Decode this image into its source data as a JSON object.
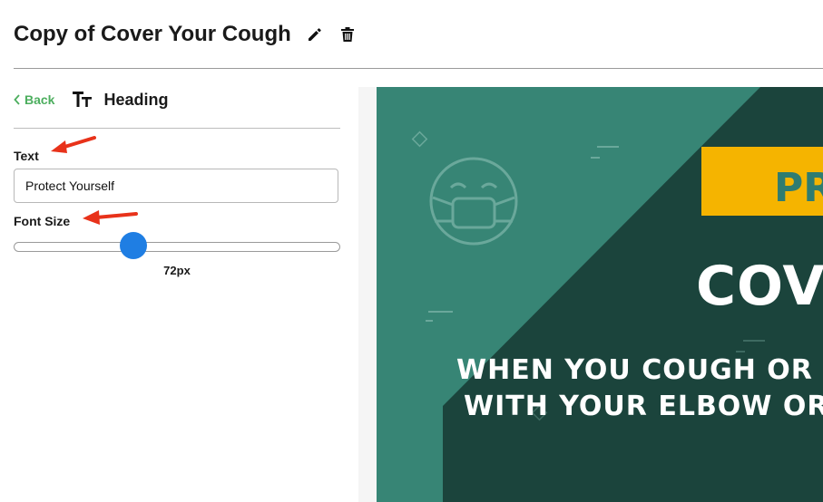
{
  "page": {
    "title": "Copy of Cover Your Cough"
  },
  "toolbar": {
    "edit_icon": "pencil-icon",
    "delete_icon": "trash-icon"
  },
  "panel": {
    "back_label": "Back",
    "section_icon": "text-type-icon",
    "section_title": "Heading",
    "text_label": "Text",
    "text_value": "Protect Yourself",
    "font_size_label": "Font Size",
    "font_size_value": "72px",
    "font_size_fraction": 0.37
  },
  "preview": {
    "badge_text": "PR",
    "headline": "COVE",
    "subline_1": "WHEN YOU COUGH OR SNE",
    "subline_2": "WITH YOUR ELBOW OR A T",
    "colors": {
      "teal": "#378575",
      "dark_green": "#1b443c",
      "badge": "#f5b400",
      "badge_text": "#2f7c70"
    }
  },
  "colors": {
    "accent_green": "#4cae5e",
    "slider_blue": "#1f7ee3",
    "annotation_arrow": "#e8321a"
  }
}
